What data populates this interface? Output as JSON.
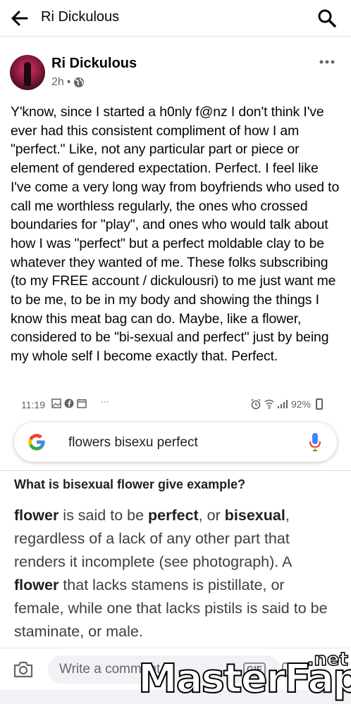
{
  "header": {
    "title": "Ri Dickulous"
  },
  "post": {
    "author": "Ri Dickulous",
    "time": "2h",
    "separator": "•",
    "paragraph": "Y'know, since I started a h0nly f@nz I don't think I've ever had this consistent compliment of how I am \"perfect.\" Like, not any particular part or piece or element of gendered expectation. Perfect. I feel like I've come a very long way from boyfriends who used to call me worthless regularly, the ones who crossed boundaries for \"play\", and ones who would talk about how I was \"perfect\" but a perfect moldable clay to be whatever they wanted of me. These folks subscribing (to my FREE account / dickulousri) to me just want me to be me, to be in my body and showing the things I know this meat bag can do. Maybe, like a flower, considered to be \"bi-sexual and perfect\" just by being my whole self I become exactly that. Perfect."
  },
  "embedded_screenshot": {
    "status_time": "11:19",
    "status_more": "···",
    "battery": "92%",
    "search_query": "flowers bisexu perfect",
    "question": "What is bisexual flower give example?",
    "answer": {
      "term1": "flower",
      "seg1": " is said to be ",
      "term2": "perfect",
      "seg2": ", or ",
      "term3": "bisexual",
      "seg3": ", regardless of a lack of any other part that renders it incomplete (see photograph). A ",
      "term4": "flower",
      "seg4": " that lacks stamens is pistillate, or female, while one that lacks pistils is said to be staminate, or male."
    }
  },
  "comment_bar": {
    "placeholder": "Write a comment...",
    "gif_label": "GIF"
  },
  "watermark": {
    "text": "MasterFap",
    "tld": ".net"
  },
  "icons": {
    "back": "arrow-left-icon",
    "search": "search-icon",
    "more": "more-horizontal-icon",
    "privacy": "globe-icon",
    "camera": "camera-icon",
    "google": "google-logo-icon",
    "mic": "microphone-icon"
  },
  "colors": {
    "text_primary": "#050505",
    "text_secondary": "#65676b",
    "google_blue": "#4285f4",
    "google_red": "#ea4335",
    "google_yellow": "#fbbc05",
    "google_green": "#34a853",
    "input_bg": "#f0f2f5"
  }
}
